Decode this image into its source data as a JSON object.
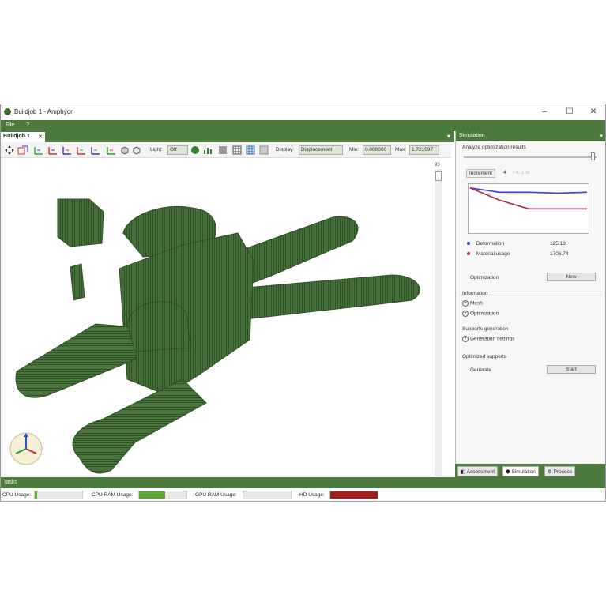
{
  "window": {
    "title": "Buildjob 1 - Amphyon"
  },
  "menu": {
    "file": "File",
    "help": "?"
  },
  "doc_tab": {
    "label": "Buildjob 1",
    "close": "✕"
  },
  "toolbar": {
    "light_label": "Light:",
    "light_value": "Off",
    "display_label": "Display:",
    "display_value": "Displacement",
    "min_label": "Min:",
    "min_value": "0.000000",
    "max_label": "Max:",
    "max_value": "1.721597"
  },
  "viewport": {
    "slider_value": "93"
  },
  "panel": {
    "title": "Simulation",
    "analyze_label": "Analyze optimization results",
    "increment_label": "Increment",
    "increment_value": "4",
    "increment_suffix": "/ 4: 1 Itr",
    "legend": [
      {
        "name": "Deformation",
        "value": "125.13",
        "color": "#3a3fd1"
      },
      {
        "name": "Material usage",
        "value": "1706.74",
        "color": "#b0294a"
      }
    ],
    "optimization_label": "Optimization",
    "optimization_button": "New",
    "information_label": "Information",
    "info_items": [
      "Mesh",
      "Optimization"
    ],
    "supports_gen_label": "Supports generation",
    "gen_settings": "Generation settings",
    "optimized_supports_label": "Optimized supports",
    "generate_label": "Generate",
    "start_button": "Start"
  },
  "chart_data": {
    "type": "line",
    "title": "",
    "xlabel": "",
    "ylabel": "",
    "x": [
      0,
      1,
      2,
      3,
      4
    ],
    "series": [
      {
        "name": "Deformation",
        "values": [
          1.0,
          0.9,
          0.9,
          0.88,
          0.9
        ],
        "color": "#3a3fd1"
      },
      {
        "name": "Material usage",
        "values": [
          1.0,
          0.72,
          0.52,
          0.52,
          0.52
        ],
        "color": "#b0294a"
      }
    ],
    "ylim": [
      0,
      1.05
    ],
    "grid": false
  },
  "panel_tabs": [
    "Assessment",
    "Simulation",
    "Process"
  ],
  "tasks_label": "Tasks",
  "status": {
    "cpu_label": "CPU Usage:",
    "cpu_ram_label": "CPU RAM Usage:",
    "gpu_ram_label": "GPU RAM Usage:",
    "hd_label": "HD Usage:",
    "cpu_fraction": 0.05,
    "cpu_ram_fraction": 0.55,
    "gpu_ram_fraction": 0.0,
    "hd_fraction": 1.0,
    "meter_green": "#5aa832",
    "meter_red": "#a31b1b"
  },
  "colors": {
    "accent": "#4b7a3c",
    "model": "#3f6432"
  }
}
